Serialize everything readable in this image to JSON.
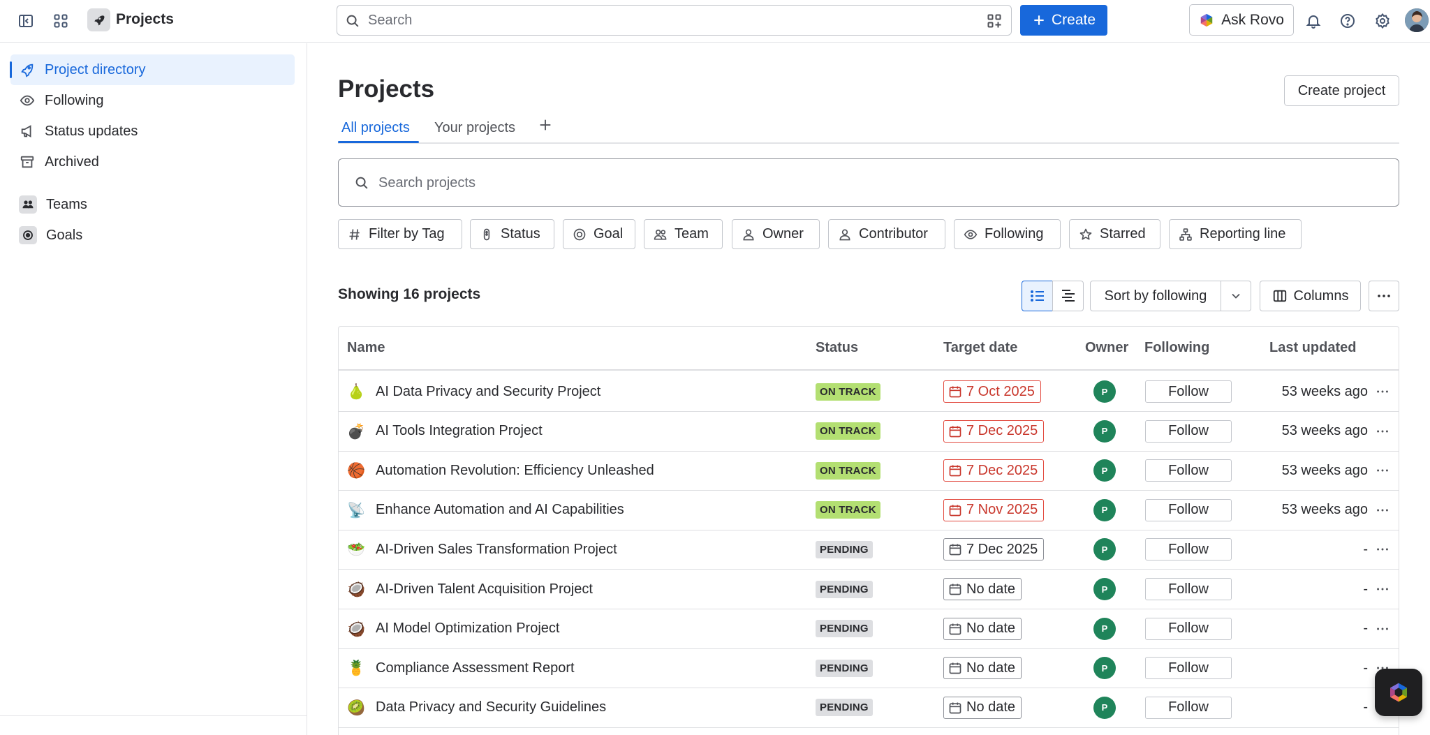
{
  "topbar": {
    "app_title": "Projects",
    "search_placeholder": "Search",
    "create_label": "Create",
    "ask_rovo_label": "Ask Rovo",
    "icons": [
      "sidebar-toggle-icon",
      "app-switcher-icon",
      "rocket-icon",
      "search-icon",
      "qr-code-icon",
      "plus-icon",
      "rovo-logo-icon",
      "bell-icon",
      "help-icon",
      "gear-icon"
    ]
  },
  "sidebar": {
    "items": [
      {
        "label": "Project directory",
        "icon": "rocket-icon",
        "active": true
      },
      {
        "label": "Following",
        "icon": "eye-icon",
        "active": false
      },
      {
        "label": "Status updates",
        "icon": "megaphone-icon",
        "active": false
      },
      {
        "label": "Archived",
        "icon": "archive-icon",
        "active": false
      }
    ],
    "sections": [
      {
        "label": "Teams",
        "icon": "people-icon"
      },
      {
        "label": "Goals",
        "icon": "target-icon"
      }
    ]
  },
  "main": {
    "title": "Projects",
    "create_project_label": "Create project",
    "tabs": [
      {
        "label": "All projects",
        "active": true
      },
      {
        "label": "Your projects",
        "active": false
      }
    ],
    "search_placeholder": "Search projects",
    "filters": [
      {
        "label": "Filter by Tag",
        "icon": "hash-icon"
      },
      {
        "label": "Status",
        "icon": "status-icon"
      },
      {
        "label": "Goal",
        "icon": "target-icon"
      },
      {
        "label": "Team",
        "icon": "people-icon"
      },
      {
        "label": "Owner",
        "icon": "person-icon"
      },
      {
        "label": "Contributor",
        "icon": "person-icon"
      },
      {
        "label": "Following",
        "icon": "eye-icon"
      },
      {
        "label": "Starred",
        "icon": "star-icon"
      },
      {
        "label": "Reporting line",
        "icon": "hierarchy-icon"
      }
    ],
    "showing_label": "Showing 16 projects",
    "sort_label": "Sort by following",
    "columns_label": "Columns"
  },
  "table": {
    "headers": {
      "name": "Name",
      "status": "Status",
      "target_date": "Target date",
      "owner": "Owner",
      "following": "Following",
      "last_updated": "Last updated"
    },
    "rows": [
      {
        "emoji": "🍐",
        "name": "AI Data Privacy and Security Project",
        "status": "ON TRACK",
        "status_color": "#B3DF72",
        "target_date": "7 Oct 2025",
        "overdue": true,
        "owner_initial": "P",
        "follow_label": "Follow",
        "last_updated": "53 weeks ago"
      },
      {
        "emoji": "💣",
        "name": "AI Tools Integration Project",
        "status": "ON TRACK",
        "status_color": "#B3DF72",
        "target_date": "7 Dec 2025",
        "overdue": true,
        "owner_initial": "P",
        "follow_label": "Follow",
        "last_updated": "53 weeks ago"
      },
      {
        "emoji": "🏀",
        "name": "Automation Revolution: Efficiency Unleashed",
        "status": "ON TRACK",
        "status_color": "#B3DF72",
        "target_date": "7 Dec 2025",
        "overdue": true,
        "owner_initial": "P",
        "follow_label": "Follow",
        "last_updated": "53 weeks ago"
      },
      {
        "emoji": "📡",
        "name": "Enhance Automation and AI Capabilities",
        "status": "ON TRACK",
        "status_color": "#B3DF72",
        "target_date": "7 Nov 2025",
        "overdue": true,
        "owner_initial": "P",
        "follow_label": "Follow",
        "last_updated": "53 weeks ago"
      },
      {
        "emoji": "🥗",
        "name": "AI-Driven Sales Transformation Project",
        "status": "PENDING",
        "status_color": "#DDDEE1",
        "target_date": "7 Dec 2025",
        "overdue": false,
        "owner_initial": "P",
        "follow_label": "Follow",
        "last_updated": "-"
      },
      {
        "emoji": "🥥",
        "name": "AI-Driven Talent Acquisition Project",
        "status": "PENDING",
        "status_color": "#DDDEE1",
        "target_date": "No date",
        "overdue": false,
        "owner_initial": "P",
        "follow_label": "Follow",
        "last_updated": "-"
      },
      {
        "emoji": "🥥",
        "name": "AI Model Optimization Project",
        "status": "PENDING",
        "status_color": "#DDDEE1",
        "target_date": "No date",
        "overdue": false,
        "owner_initial": "P",
        "follow_label": "Follow",
        "last_updated": "-"
      },
      {
        "emoji": "🍍",
        "name": "Compliance Assessment Report",
        "status": "PENDING",
        "status_color": "#DDDEE1",
        "target_date": "No date",
        "overdue": false,
        "owner_initial": "P",
        "follow_label": "Follow",
        "last_updated": "-"
      },
      {
        "emoji": "🥝",
        "name": "Data Privacy and Security Guidelines",
        "status": "PENDING",
        "status_color": "#DDDEE1",
        "target_date": "No date",
        "overdue": false,
        "owner_initial": "P",
        "follow_label": "Follow",
        "last_updated": "-"
      }
    ]
  },
  "colors": {
    "accent": "#1868DB",
    "on_track": "#B3DF72",
    "pending": "#DDDEE1",
    "overdue": "#C9372C",
    "owner_avatar": "#1F845A"
  }
}
